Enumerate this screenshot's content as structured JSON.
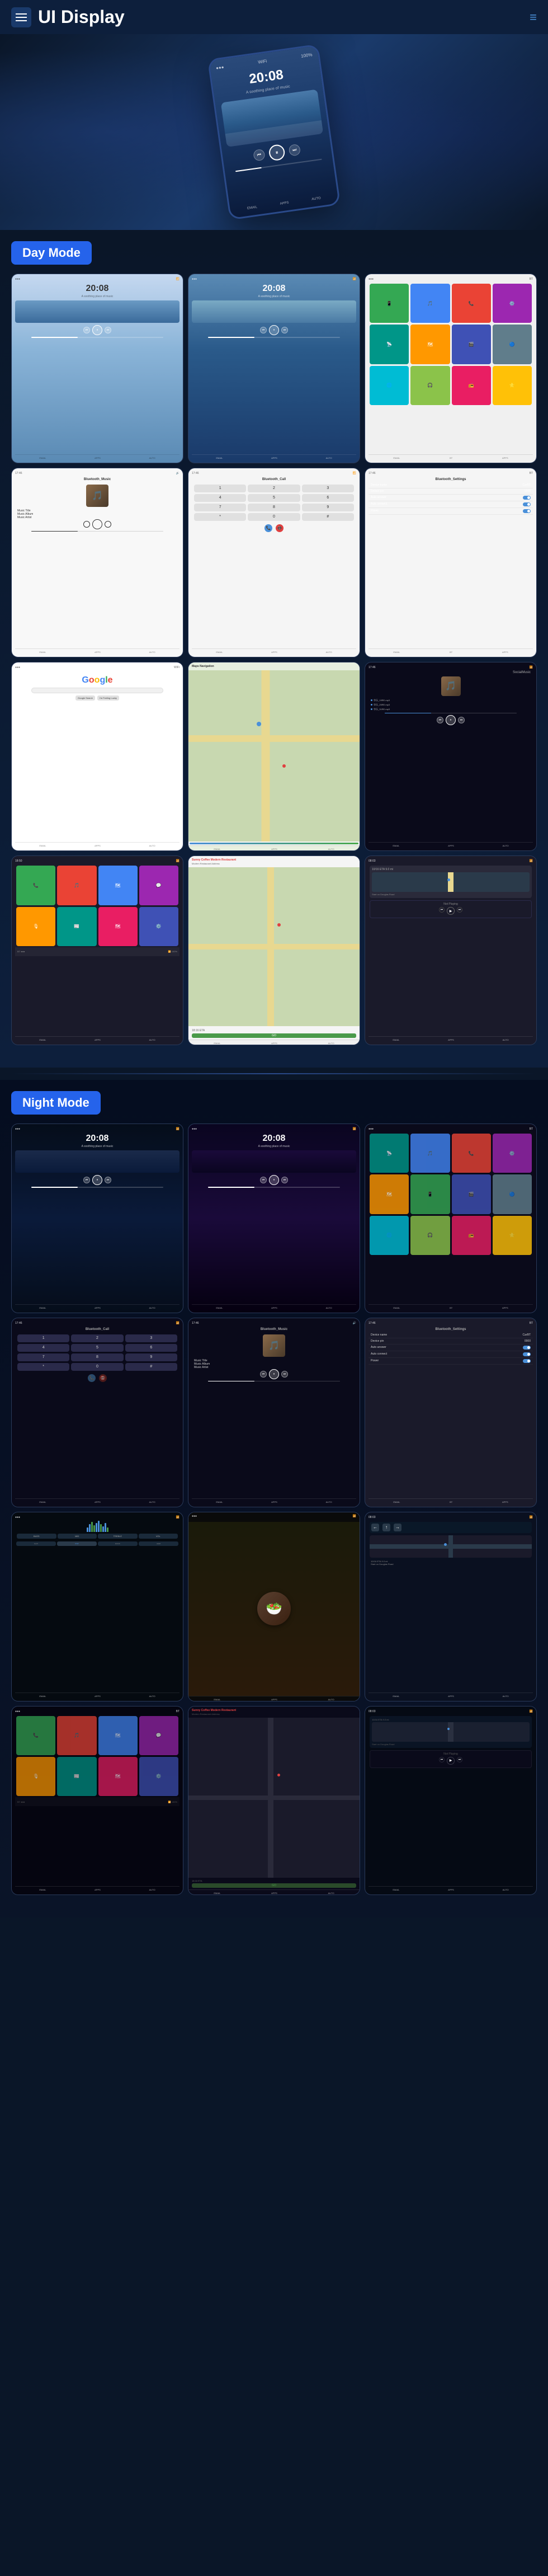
{
  "header": {
    "title": "UI Display",
    "menu_label": "menu",
    "nav_label": "navigation"
  },
  "hero": {
    "phone_time": "20:08",
    "phone_subtitle": "A soothing place of music"
  },
  "day_mode": {
    "label": "Day Mode",
    "screens": [
      {
        "id": "day-music-1",
        "type": "music-landscape",
        "time": "20:08",
        "subtitle": "A soothing place of music"
      },
      {
        "id": "day-music-2",
        "type": "music-landscape",
        "time": "20:08",
        "subtitle": "A soothing place of music"
      },
      {
        "id": "day-apps",
        "type": "app-grid"
      },
      {
        "id": "day-bt-music",
        "type": "bluetooth-music",
        "title": "Bluetooth_Music",
        "track": "Music Title",
        "album": "Music Album",
        "artist": "Music Artist"
      },
      {
        "id": "day-bt-call",
        "type": "bluetooth-call",
        "title": "Bluetooth_Call"
      },
      {
        "id": "day-bt-settings",
        "type": "bluetooth-settings",
        "title": "Bluetooth_Settings"
      },
      {
        "id": "day-google",
        "type": "google"
      },
      {
        "id": "day-map",
        "type": "map"
      },
      {
        "id": "day-social",
        "type": "social-music",
        "title": "SocialMusic"
      },
      {
        "id": "day-apps2",
        "type": "app-grid-2"
      },
      {
        "id": "day-restaurant",
        "type": "restaurant",
        "name": "Sunny Coffee Modern Restaurant"
      },
      {
        "id": "day-notplaying",
        "type": "not-playing"
      }
    ]
  },
  "night_mode": {
    "label": "Night Mode",
    "screens": [
      {
        "id": "night-music-1",
        "type": "music-landscape-night",
        "time": "20:08"
      },
      {
        "id": "night-music-2",
        "type": "music-landscape-night-2",
        "time": "20:08"
      },
      {
        "id": "night-apps",
        "type": "app-grid-night"
      },
      {
        "id": "night-bt-call",
        "type": "bluetooth-call-night",
        "title": "Bluetooth_Call"
      },
      {
        "id": "night-bt-music",
        "type": "bluetooth-music-night",
        "title": "Bluetooth_Music"
      },
      {
        "id": "night-bt-settings",
        "type": "bluetooth-settings-night",
        "title": "Bluetooth_Settings"
      },
      {
        "id": "night-waveform",
        "type": "waveform-night"
      },
      {
        "id": "night-food",
        "type": "food-night"
      },
      {
        "id": "night-nav",
        "type": "navigation-night"
      },
      {
        "id": "night-apps2",
        "type": "app-grid-night-2"
      },
      {
        "id": "night-restaurant",
        "type": "restaurant-night"
      },
      {
        "id": "night-notplaying",
        "type": "not-playing-night"
      }
    ]
  },
  "app_icons": {
    "colors": [
      "ic-green",
      "ic-red",
      "ic-blue",
      "ic-purple",
      "ic-orange",
      "ic-teal",
      "ic-pink",
      "ic-indigo",
      "ic-cyan",
      "ic-lime",
      "ic-amber",
      "ic-brown",
      "ic-grey",
      "ic-bluegrey",
      "ic-deep-purple",
      "ic-blue"
    ],
    "emojis": [
      "📱",
      "🎵",
      "🗺",
      "⚙️",
      "📞",
      "🎬",
      "📷",
      "🔵",
      "💬",
      "🌐",
      "🎧",
      "📻",
      "⭐",
      "📺",
      "🔧",
      "📡"
    ]
  },
  "restaurant": {
    "name": "Sunny Coffee Modern Restaurant",
    "address": "Address details here",
    "go_label": "GO",
    "eta_label": "18:16 ETA"
  },
  "navigation": {
    "eta": "10/16 ETA  9.0 mi",
    "road": "Start on Douglas Road",
    "not_playing": "Not Playing"
  },
  "music": {
    "title": "Music Title",
    "album": "Music Album",
    "artist": "Music Artist"
  },
  "bluetooth": {
    "device_name_label": "Device name",
    "device_name_val": "CarBT",
    "device_pin_label": "Device pin",
    "device_pin_val": "0000",
    "auto_answer_label": "Auto answer",
    "auto_connect_label": "Auto connect",
    "power_label": "Power"
  }
}
